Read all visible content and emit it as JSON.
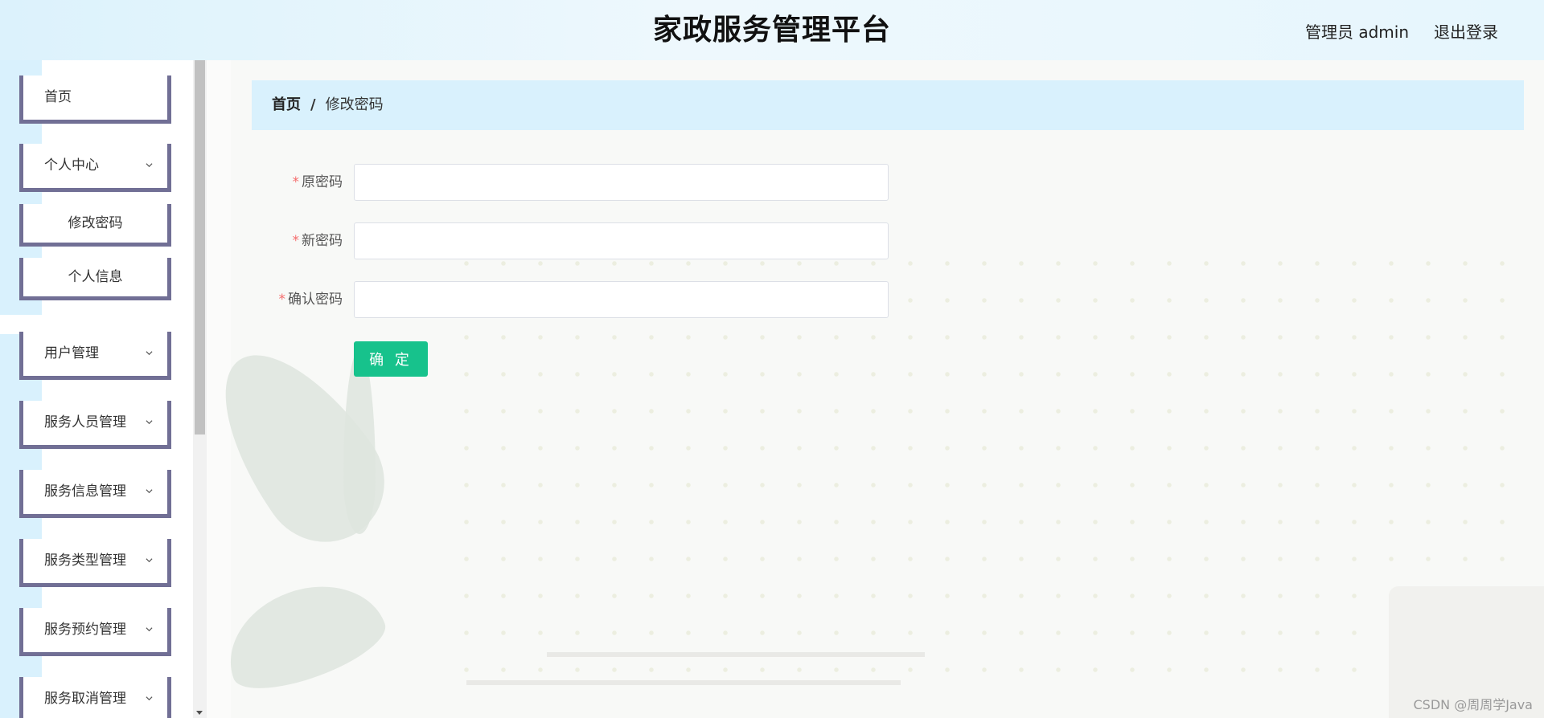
{
  "header": {
    "title": "家政服务管理平台",
    "user": "管理员 admin",
    "logout": "退出登录"
  },
  "sidebar": {
    "items": [
      {
        "label": "首页",
        "expandable": false
      },
      {
        "label": "个人中心",
        "expandable": true
      },
      {
        "label": "修改密码",
        "expandable": false,
        "sub": true
      },
      {
        "label": "个人信息",
        "expandable": false,
        "sub": true
      },
      {
        "label": "用户管理",
        "expandable": true
      },
      {
        "label": "服务人员管理",
        "expandable": true
      },
      {
        "label": "服务信息管理",
        "expandable": true
      },
      {
        "label": "服务类型管理",
        "expandable": true
      },
      {
        "label": "服务预约管理",
        "expandable": true
      },
      {
        "label": "服务取消管理",
        "expandable": true
      }
    ]
  },
  "breadcrumb": {
    "home": "首页",
    "separator": "/",
    "current": "修改密码"
  },
  "form": {
    "fields": [
      {
        "label": "原密码",
        "required": true,
        "value": "",
        "placeholder": ""
      },
      {
        "label": "新密码",
        "required": true,
        "value": "",
        "placeholder": ""
      },
      {
        "label": "确认密码",
        "required": true,
        "value": "",
        "placeholder": ""
      }
    ],
    "submit_label": "确 定",
    "required_mark": "*"
  },
  "watermark": "CSDN @周周学Java",
  "colors": {
    "header_bg": "#dcf2fc",
    "sidebar_border": "#716f95",
    "breadcrumb_bg": "#d9f1fd",
    "submit_bg": "#17c28c",
    "required": "#f56c6c"
  }
}
